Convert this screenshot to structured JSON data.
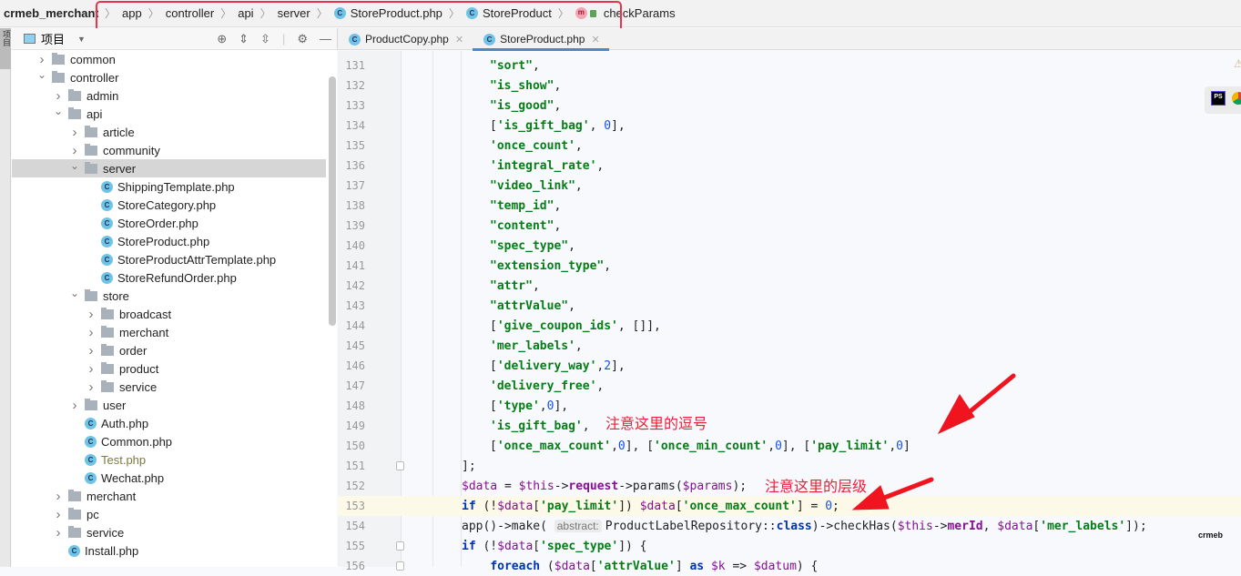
{
  "breadcrumb": {
    "project": "crmeb_merchant",
    "items": [
      {
        "label": "app",
        "icon": null
      },
      {
        "label": "controller",
        "icon": null
      },
      {
        "label": "api",
        "icon": null
      },
      {
        "label": "server",
        "icon": null
      },
      {
        "label": "StoreProduct.php",
        "icon": "class-icon"
      },
      {
        "label": "StoreProduct",
        "icon": "class-icon"
      },
      {
        "label": "checkParams",
        "icon": "method-icon"
      }
    ],
    "highlight_color": "#e8334a"
  },
  "side_strip": {
    "label": "项目"
  },
  "project_panel": {
    "title": "项目",
    "tree": [
      {
        "label": "common",
        "type": "folder",
        "depth": 2,
        "expanded": false
      },
      {
        "label": "controller",
        "type": "folder",
        "depth": 2,
        "expanded": true
      },
      {
        "label": "admin",
        "type": "folder",
        "depth": 3,
        "expanded": false
      },
      {
        "label": "api",
        "type": "folder",
        "depth": 3,
        "expanded": true
      },
      {
        "label": "article",
        "type": "folder",
        "depth": 4,
        "expanded": false
      },
      {
        "label": "community",
        "type": "folder",
        "depth": 4,
        "expanded": false
      },
      {
        "label": "server",
        "type": "folder",
        "depth": 4,
        "expanded": true,
        "selected": true
      },
      {
        "label": "ShippingTemplate.php",
        "type": "file",
        "depth": 5
      },
      {
        "label": "StoreCategory.php",
        "type": "file",
        "depth": 5
      },
      {
        "label": "StoreOrder.php",
        "type": "file",
        "depth": 5
      },
      {
        "label": "StoreProduct.php",
        "type": "file",
        "depth": 5
      },
      {
        "label": "StoreProductAttrTemplate.php",
        "type": "file",
        "depth": 5
      },
      {
        "label": "StoreRefundOrder.php",
        "type": "file",
        "depth": 5
      },
      {
        "label": "store",
        "type": "folder",
        "depth": 4,
        "expanded": true
      },
      {
        "label": "broadcast",
        "type": "folder",
        "depth": 5,
        "expanded": false
      },
      {
        "label": "merchant",
        "type": "folder",
        "depth": 5,
        "expanded": false
      },
      {
        "label": "order",
        "type": "folder",
        "depth": 5,
        "expanded": false
      },
      {
        "label": "product",
        "type": "folder",
        "depth": 5,
        "expanded": false
      },
      {
        "label": "service",
        "type": "folder",
        "depth": 5,
        "expanded": false
      },
      {
        "label": "user",
        "type": "folder",
        "depth": 4,
        "expanded": false
      },
      {
        "label": "Auth.php",
        "type": "file",
        "depth": 4
      },
      {
        "label": "Common.php",
        "type": "file",
        "depth": 4
      },
      {
        "label": "Test.php",
        "type": "file",
        "depth": 4,
        "modified": true
      },
      {
        "label": "Wechat.php",
        "type": "file",
        "depth": 4
      },
      {
        "label": "merchant",
        "type": "folder",
        "depth": 3,
        "expanded": false
      },
      {
        "label": "pc",
        "type": "folder",
        "depth": 3,
        "expanded": false
      },
      {
        "label": "service",
        "type": "folder",
        "depth": 3,
        "expanded": false
      },
      {
        "label": "Install.php",
        "type": "file",
        "depth": 3
      }
    ]
  },
  "tabs": [
    {
      "label": "ProductCopy.php",
      "active": false
    },
    {
      "label": "StoreProduct.php",
      "active": true
    }
  ],
  "editor": {
    "current_line": 153,
    "lines": [
      {
        "n": 131,
        "html": "<span class=\"s\">\"sort\"</span>,"
      },
      {
        "n": 132,
        "html": "<span class=\"s\">\"is_show\"</span>,"
      },
      {
        "n": 133,
        "html": "<span class=\"s\">\"is_good\"</span>,"
      },
      {
        "n": 134,
        "html": "[<span class=\"s\">'is_gift_bag'</span>, <span class=\"n\">0</span>],"
      },
      {
        "n": 135,
        "html": "<span class=\"s\">'once_count'</span>,"
      },
      {
        "n": 136,
        "html": "<span class=\"s\">'integral_rate'</span>,"
      },
      {
        "n": 137,
        "html": "<span class=\"s\">\"video_link\"</span>,"
      },
      {
        "n": 138,
        "html": "<span class=\"s\">\"temp_id\"</span>,"
      },
      {
        "n": 139,
        "html": "<span class=\"s\">\"content\"</span>,"
      },
      {
        "n": 140,
        "html": "<span class=\"s\">\"spec_type\"</span>,"
      },
      {
        "n": 141,
        "html": "<span class=\"s\">\"extension_type\"</span>,"
      },
      {
        "n": 142,
        "html": "<span class=\"s\">\"attr\"</span>,"
      },
      {
        "n": 143,
        "html": "<span class=\"s\">\"attrValue\"</span>,"
      },
      {
        "n": 144,
        "html": "[<span class=\"s\">'give_coupon_ids'</span>, []],"
      },
      {
        "n": 145,
        "html": "<span class=\"s\">'mer_labels'</span>,"
      },
      {
        "n": 146,
        "html": "[<span class=\"s\">'delivery_way'</span>,<span class=\"n\">2</span>],"
      },
      {
        "n": 147,
        "html": "<span class=\"s\">'delivery_free'</span>,"
      },
      {
        "n": 148,
        "html": "[<span class=\"s\">'type'</span>,<span class=\"n\">0</span>],"
      },
      {
        "n": 149,
        "html": "<span class=\"s\">'is_gift_bag'</span>,"
      },
      {
        "n": 150,
        "html": "[<span class=\"s\">'once_max_count'</span>,<span class=\"n\">0</span>], [<span class=\"s\">'once_min_count'</span>,<span class=\"n\">0</span>], [<span class=\"s\">'pay_limit'</span>,<span class=\"n\">0</span>]"
      },
      {
        "n": 151,
        "html": "];"
      },
      {
        "n": 152,
        "html": "<span class=\"v\">$data</span> = <span class=\"v\">$this</span>-><span class=\"pr\">request</span>->params(<span class=\"v\">$params</span>);"
      },
      {
        "n": 153,
        "html": "<span class=\"k\">if</span> (!<span class=\"v\">$data</span>[<span class=\"s\">'pay_limit'</span>]) <span class=\"v\">$data</span>[<span class=\"s\">'once_max_count'</span>] = <span class=\"n\">0</span>;"
      },
      {
        "n": 154,
        "html": "app()->make( <span class=\"hint\">abstract:</span>ProductLabelRepository::<span class=\"k\">class</span>)->checkHas(<span class=\"v\">$this</span>-><span class=\"pr\">merId</span>, <span class=\"v\">$data</span>[<span class=\"s\">'mer_labels'</span>]);"
      },
      {
        "n": 155,
        "html": "<span class=\"k\">if</span> (!<span class=\"v\">$data</span>[<span class=\"s\">'spec_type'</span>]) {"
      },
      {
        "n": 156,
        "html": "    <span class=\"k\">foreach</span> (<span class=\"v\">$data</span>[<span class=\"s\">'attrValue'</span>] <span class=\"k\">as</span> <span class=\"v\">$k</span> => <span class=\"v\">$datum</span>) {"
      }
    ]
  },
  "annotations": [
    {
      "text": "注意这里的逗号",
      "color": "#e8223a"
    },
    {
      "text": "注意这里的层级",
      "color": "#e8223a"
    }
  ],
  "floating": {
    "ps_label": "PS",
    "watermark": "crmeb"
  }
}
